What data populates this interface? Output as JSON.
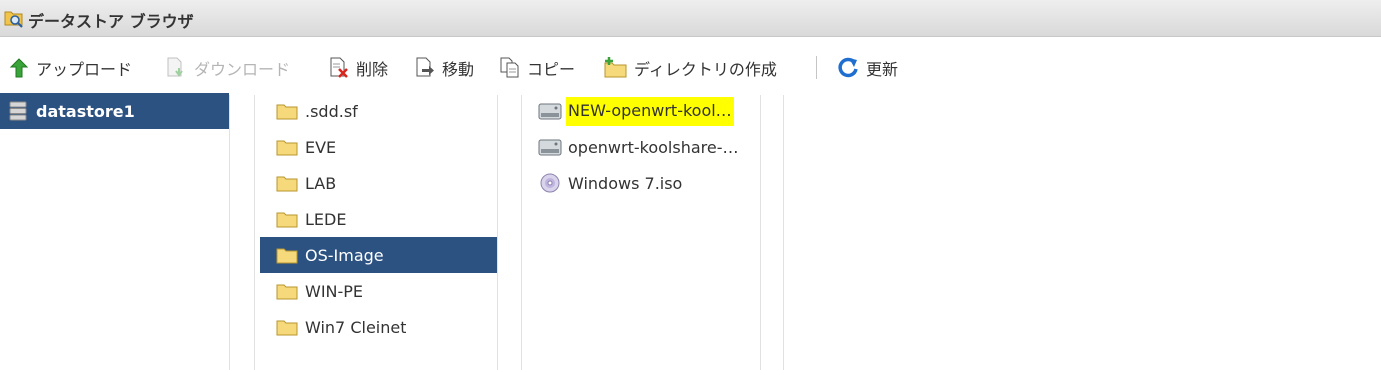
{
  "window": {
    "title": "データストア ブラウザ"
  },
  "toolbar": {
    "upload": "アップロード",
    "download": "ダウンロード",
    "delete": "削除",
    "move": "移動",
    "copy": "コピー",
    "mkdir": "ディレクトリの作成",
    "refresh": "更新"
  },
  "datastores": [
    {
      "name": "datastore1",
      "selected": true
    }
  ],
  "folders": [
    {
      "name": ".sdd.sf",
      "selected": false
    },
    {
      "name": "EVE",
      "selected": false
    },
    {
      "name": "LAB",
      "selected": false
    },
    {
      "name": "LEDE",
      "selected": false
    },
    {
      "name": "OS-Image",
      "selected": true
    },
    {
      "name": "WIN-PE",
      "selected": false
    },
    {
      "name": "Win7 Cleinet",
      "selected": false
    }
  ],
  "files": [
    {
      "name": "NEW-openwrt-kool…",
      "type": "disk",
      "highlighted": true
    },
    {
      "name": "openwrt-koolshare-…",
      "type": "disk",
      "highlighted": false
    },
    {
      "name": "Windows 7.iso",
      "type": "iso",
      "highlighted": false
    }
  ],
  "colors": {
    "selection": "#2c5282",
    "highlight": "#ffff00",
    "titlebar": "#e3e3e3"
  }
}
